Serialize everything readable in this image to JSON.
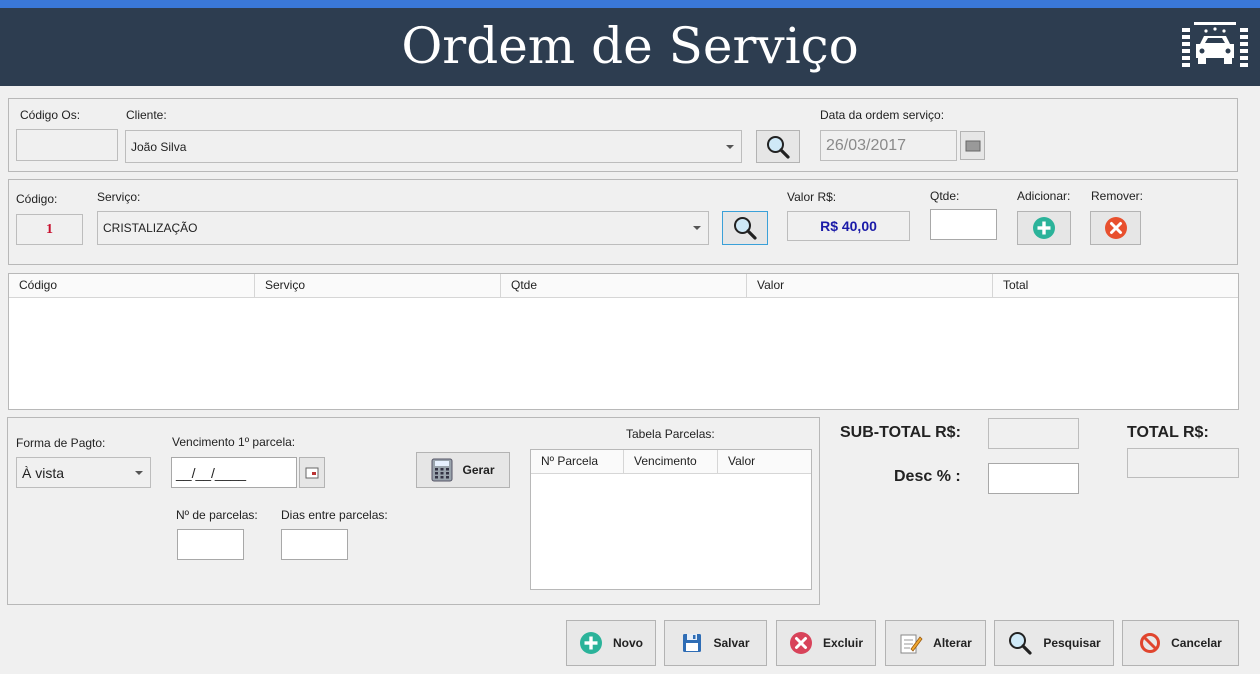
{
  "header": {
    "title": "Ordem de Serviço"
  },
  "os": {
    "codigo_os_label": "Código Os:",
    "codigo_os_value": "",
    "cliente_label": "Cliente:",
    "cliente_value": "João Silva",
    "data_label": "Data da ordem serviço:",
    "data_value": "26/03/2017"
  },
  "servico": {
    "codigo_label": "Código:",
    "codigo_value": "1",
    "servico_label": "Serviço:",
    "servico_value": "CRISTALIZAÇÃO",
    "valor_label": "Valor R$:",
    "valor_value": "R$ 40,00",
    "qtde_label": "Qtde:",
    "qtde_value": "",
    "adicionar_label": "Adicionar:",
    "remover_label": "Remover:"
  },
  "grid": {
    "columns": [
      "Código",
      "Serviço",
      "Qtde",
      "Valor",
      "Total"
    ],
    "rows": []
  },
  "pagamento": {
    "forma_label": "Forma de Pagto:",
    "forma_value": "À vista",
    "vencimento_label": "Vencimento 1º parcela:",
    "vencimento_value": "__/__/____",
    "parcelas_label": "Nº de parcelas:",
    "parcelas_value": "",
    "dias_label": "Dias entre parcelas:",
    "dias_value": "",
    "gerar_label": "Gerar",
    "tabela_label": "Tabela Parcelas:",
    "tabela_columns": [
      "Nº Parcela",
      "Vencimento",
      "Valor"
    ]
  },
  "totais": {
    "subtotal_label": "SUB-TOTAL R$:",
    "subtotal_value": "",
    "desc_label": "Desc % :",
    "desc_value": "",
    "total_label": "TOTAL R$:",
    "total_value": ""
  },
  "actions": {
    "novo": "Novo",
    "salvar": "Salvar",
    "excluir": "Excluir",
    "alterar": "Alterar",
    "pesquisar": "Pesquisar",
    "cancelar": "Cancelar"
  },
  "colors": {
    "header_bg": "#2d3d50",
    "accent_blue": "#3a78d8",
    "value_red": "#c8102e",
    "value_blue": "#1a1aa8",
    "add_green": "#2bb39a",
    "remove_red": "#e8502e"
  }
}
